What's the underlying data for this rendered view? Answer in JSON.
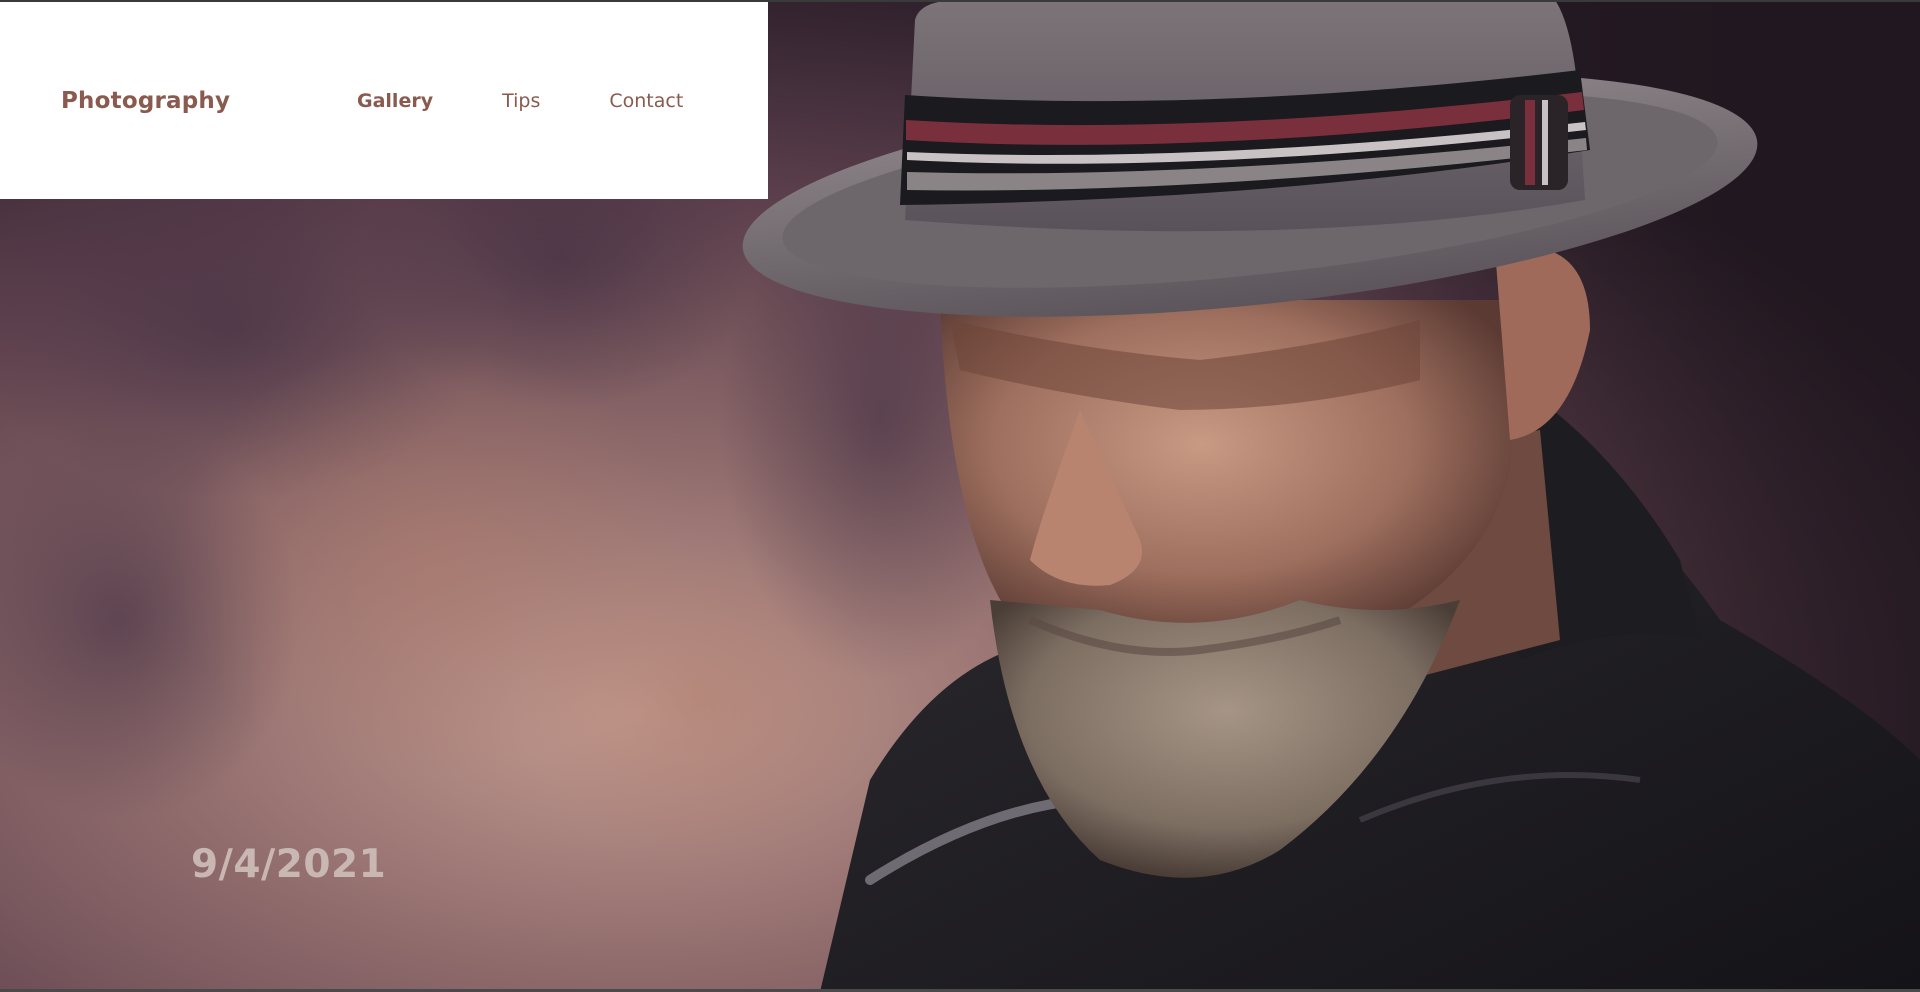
{
  "site": {
    "brand": "Photography"
  },
  "nav": {
    "items": [
      {
        "label": "Gallery",
        "active": true
      },
      {
        "label": "Tips",
        "active": false
      },
      {
        "label": "Contact",
        "active": false
      }
    ]
  },
  "hero": {
    "date": "9/4/2021"
  },
  "colors": {
    "brand": "#8a5a4e",
    "nav_bg": "#ffffff",
    "date_text": "#c9b7b4",
    "backdrop": "#6b4a4f"
  }
}
